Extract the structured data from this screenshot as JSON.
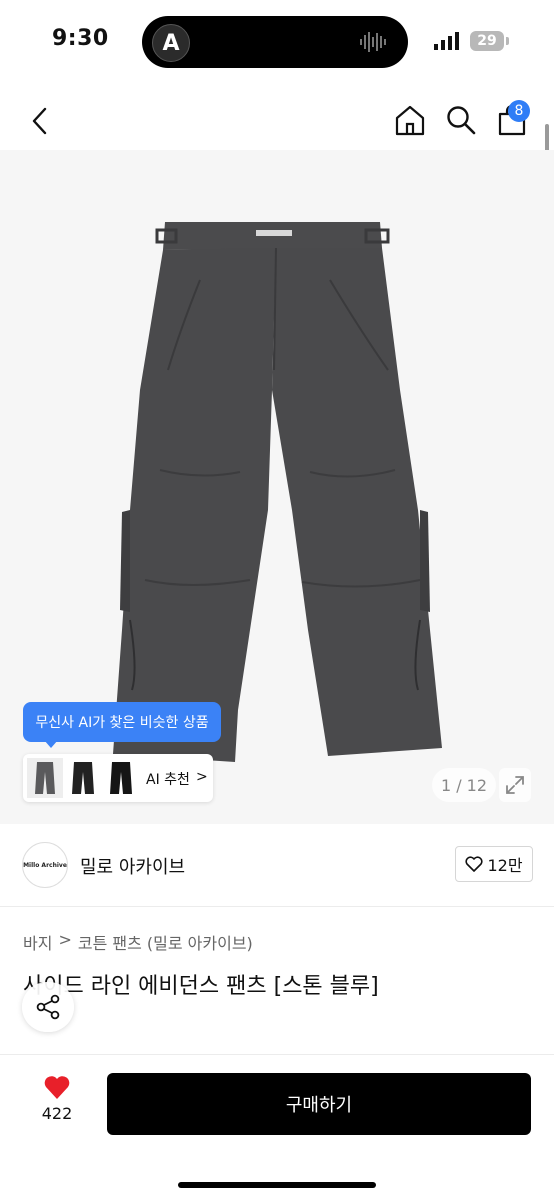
{
  "status_bar": {
    "time": "9:30",
    "battery": "29",
    "island_logo": "A"
  },
  "nav": {
    "cart_count": "8",
    "icons": [
      "back-icon",
      "home-icon",
      "search-icon",
      "cart-icon"
    ]
  },
  "gallery": {
    "ai_tooltip": "무신사 AI가 찾은 비슷한 상품",
    "ai_button": "AI 추천",
    "ai_chevron": ">",
    "counter": "1 / 12"
  },
  "brand": {
    "name": "밀로 아카이브",
    "logo_text": "Millo Archive",
    "likes": "12만"
  },
  "breadcrumb": {
    "category": "바지",
    "separator": ">",
    "subcategory": "코튼 팬츠 (밀로 아카이브)"
  },
  "product": {
    "title": "사이드 라인 에비던스 팬츠 [스톤 블루]"
  },
  "bottom_bar": {
    "heart_count": "422",
    "buy_label": "구매하기"
  },
  "colors": {
    "accent": "#3b82f6",
    "heart": "#e8202a",
    "buy": "#000000",
    "pants": "#4a4a4c"
  }
}
